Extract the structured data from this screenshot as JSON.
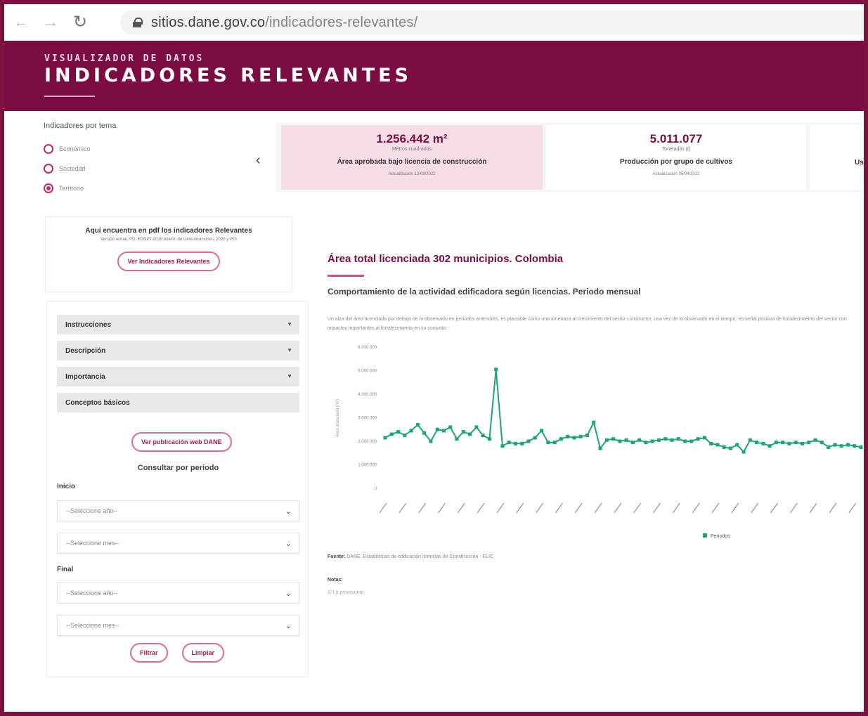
{
  "browser": {
    "url_host": "sitios.dane.gov.co",
    "url_path": "/indicadores-relevantes/"
  },
  "header": {
    "pretitle": "VISUALIZADOR DE DATOS",
    "title": "INDICADORES RELEVANTES"
  },
  "sidebar": {
    "theme_title": "Indicadores por tema",
    "themes": [
      "Económico",
      "Sociedad",
      "Territorio"
    ],
    "selected_theme": "Territorio",
    "pdf_box": {
      "title": "Aquí encuentra en pdf los indicadores Relevantes",
      "subtitle": "Versión actual, PD. EDNPT-2015 boletín de comunicaciones, 2020 y PDI",
      "button": "Ver Indicadores Relevantes"
    },
    "accordion": [
      "Instrucciones",
      "Descripción",
      "Importancia",
      "Conceptos básicos"
    ],
    "publication_button": "Ver publicación web DANE",
    "consult_title": "Consultar por periodo",
    "start_label": "Inicio",
    "end_label": "Final",
    "year_placeholder": "--Seleccione año--",
    "month_placeholder": "--Seleccione mes--",
    "filter_button": "Filtrar",
    "clear_button": "Limpiar"
  },
  "cards": [
    {
      "value": "1.256.442 m²",
      "unit": "Metros cuadrados",
      "name": "Área aprobada bajo licencia de construcción",
      "date": "Actualización 13/08/2022",
      "selected": true
    },
    {
      "value": "5.011.077",
      "unit": "Toneladas (t)",
      "name": "Producción por grupo de cultivos",
      "date": "Actualización 05/04/2022",
      "selected": false
    },
    {
      "value": "",
      "unit": "",
      "name": "Uso",
      "date": "",
      "selected": false
    }
  ],
  "main": {
    "title": "Área total licenciada 302 municipios. Colombia",
    "subtitle": "Comportamiento de la actividad edificadora según licencias. Periodo mensual",
    "description": "Un alza del área licenciada por debajo de lo observado en periodos anteriores, es plausible como una amenaza al crecimiento del sector constructor, una vez de lo observado en el tiempo, es señal positiva de fortalecimiento del sector con impactos importantes al fortalecimiento en su conjunto.",
    "source_label": "Fuente:",
    "source_text": "DANE. Estadísticas de edificación licencias de Construcción - ELIC",
    "notes_label": "Notas:",
    "notes_text": "1/ Lo provisional"
  },
  "chart_data": {
    "type": "line",
    "ylabel": "Área licenciada (m²)",
    "y_ticks": [
      "0",
      "1.000.000",
      "2.000.000",
      "3.000.000",
      "4.000.000",
      "5.000.000",
      "6.000.000"
    ],
    "ylim": [
      0,
      6000000
    ],
    "legend": "Periodos",
    "legend_position": "bottom",
    "series_color": "#1aa57a",
    "series": [
      {
        "name": "Periodos",
        "values": [
          2150000,
          2300000,
          2400000,
          2250000,
          2450000,
          2700000,
          2350000,
          2000000,
          2500000,
          2450000,
          2600000,
          2100000,
          2400000,
          2300000,
          2600000,
          2250000,
          2100000,
          5050000,
          1800000,
          1950000,
          1900000,
          1900000,
          2000000,
          2150000,
          2450000,
          1950000,
          1950000,
          2100000,
          2200000,
          2150000,
          2200000,
          2250000,
          2800000,
          1700000,
          2050000,
          2100000,
          2000000,
          2050000,
          1950000,
          2050000,
          1950000,
          2000000,
          2050000,
          2100000,
          2050000,
          2100000,
          2000000,
          2000000,
          2100000,
          2150000,
          1900000,
          1850000,
          1750000,
          1700000,
          1850000,
          1550000,
          2050000,
          1950000,
          1900000,
          1800000,
          1950000,
          1950000,
          1900000,
          1950000,
          1900000,
          1950000,
          2050000,
          1950000,
          1750000,
          1850000,
          1800000,
          1850000,
          1800000,
          1750000
        ]
      }
    ]
  }
}
